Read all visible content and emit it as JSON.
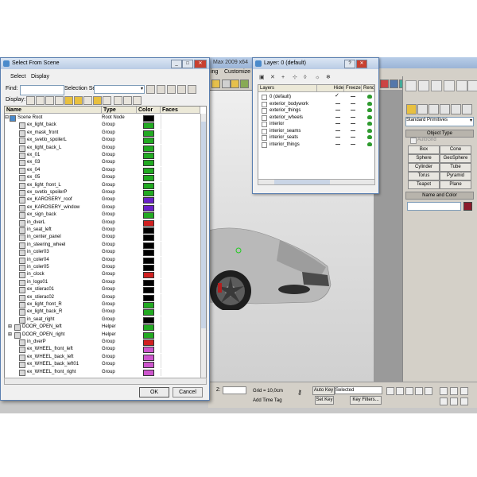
{
  "max_window": {
    "title": "Max  2009 x64",
    "menu": [
      "ing",
      "Customize"
    ],
    "viewport": {},
    "command_panel": {
      "primitive_dropdown": "Standard Primitives",
      "object_type_title": "Object Type",
      "autogrid_label": "AutoGrid",
      "primitives": [
        "Box",
        "Cone",
        "Sphere",
        "GeoSphere",
        "Cylinder",
        "Tube",
        "Torus",
        "Pyramid",
        "Teapot",
        "Plane"
      ],
      "name_color_title": "Name and Color",
      "object_color": "#8b1a2a"
    },
    "status": {
      "z_label": "Z:",
      "grid": "Grid = 10,0cm",
      "add_time_tag": "Add Time Tag",
      "auto_key": "Auto Key",
      "auto_key_value": "Selected",
      "set_key": "Set Key",
      "key_filters": "Key Filters..."
    }
  },
  "layer_window": {
    "title": "Layer: 0 (default)",
    "columns": [
      "Layers",
      "Hide",
      "Freeze",
      "Render"
    ],
    "layers": [
      {
        "name": "0 (default)",
        "current": true
      },
      {
        "name": "exterior_bodywork"
      },
      {
        "name": "exterior_things"
      },
      {
        "name": "exterior_wheels"
      },
      {
        "name": "interior"
      },
      {
        "name": "interior_seams"
      },
      {
        "name": "interior_seats"
      },
      {
        "name": "interior_things"
      }
    ]
  },
  "select_from_scene": {
    "title": "Select From Scene",
    "menu": [
      "Select",
      "Display"
    ],
    "find_label": "Find:",
    "find_value": "",
    "selection_set_label": "Selection Set:",
    "selection_set_value": "",
    "display_label": "Display:",
    "columns": [
      "Name",
      "Type",
      "Color",
      "Faces"
    ],
    "rows": [
      {
        "name": "Scene Root",
        "type": "Root Node",
        "color": "#000000",
        "indent": 0
      },
      {
        "name": "ex_light_back",
        "type": "Group",
        "color": "#22aa22",
        "indent": 1
      },
      {
        "name": "ex_mask_front",
        "type": "Group",
        "color": "#22aa22",
        "indent": 1
      },
      {
        "name": "ex_svetlo_spoilerL",
        "type": "Group",
        "color": "#22aa22",
        "indent": 1
      },
      {
        "name": "ex_light_back_L",
        "type": "Group",
        "color": "#22aa22",
        "indent": 1
      },
      {
        "name": "ex_01",
        "type": "Group",
        "color": "#22aa22",
        "indent": 1
      },
      {
        "name": "ex_03",
        "type": "Group",
        "color": "#22aa22",
        "indent": 1
      },
      {
        "name": "ex_04",
        "type": "Group",
        "color": "#22aa22",
        "indent": 1
      },
      {
        "name": "ex_05",
        "type": "Group",
        "color": "#22aa22",
        "indent": 1
      },
      {
        "name": "ex_light_front_L",
        "type": "Group",
        "color": "#22aa22",
        "indent": 1
      },
      {
        "name": "ex_svetlo_spoilerP",
        "type": "Group",
        "color": "#22aa22",
        "indent": 1
      },
      {
        "name": "ex_KAROSERY_roof",
        "type": "Group",
        "color": "#6a22c8",
        "indent": 1
      },
      {
        "name": "ex_KAROSERY_window",
        "type": "Group",
        "color": "#6a22c8",
        "indent": 1
      },
      {
        "name": "ex_sign_back",
        "type": "Group",
        "color": "#22aa22",
        "indent": 1
      },
      {
        "name": "in_dverL",
        "type": "Group",
        "color": "#d02020",
        "indent": 1
      },
      {
        "name": "in_seat_left",
        "type": "Group",
        "color": "#000000",
        "indent": 1
      },
      {
        "name": "in_center_panel",
        "type": "Group",
        "color": "#000000",
        "indent": 1
      },
      {
        "name": "in_steering_wheel",
        "type": "Group",
        "color": "#000000",
        "indent": 1
      },
      {
        "name": "in_coler03",
        "type": "Group",
        "color": "#000000",
        "indent": 1
      },
      {
        "name": "in_coler04",
        "type": "Group",
        "color": "#000000",
        "indent": 1
      },
      {
        "name": "in_coler05",
        "type": "Group",
        "color": "#000000",
        "indent": 1
      },
      {
        "name": "in_clock",
        "type": "Group",
        "color": "#d02020",
        "indent": 1
      },
      {
        "name": "in_logo01",
        "type": "Group",
        "color": "#000000",
        "indent": 1
      },
      {
        "name": "ex_stierac01",
        "type": "Group",
        "color": "#000000",
        "indent": 1
      },
      {
        "name": "ex_stierac02",
        "type": "Group",
        "color": "#000000",
        "indent": 1
      },
      {
        "name": "ex_light_front_R",
        "type": "Group",
        "color": "#22aa22",
        "indent": 1
      },
      {
        "name": "ex_light_back_R",
        "type": "Group",
        "color": "#22aa22",
        "indent": 1
      },
      {
        "name": "in_seat_right",
        "type": "Group",
        "color": "#000000",
        "indent": 1
      },
      {
        "name": "DOOR_OPEN_left",
        "type": "Helper",
        "color": "#22aa22",
        "indent": 0
      },
      {
        "name": "DOOR_OPEN_right",
        "type": "Helper",
        "color": "#22aa22",
        "indent": 0
      },
      {
        "name": "in_dverP",
        "type": "Group",
        "color": "#d02020",
        "indent": 1
      },
      {
        "name": "ex_WHEEL_front_left",
        "type": "Group",
        "color": "#cc55cc",
        "indent": 1
      },
      {
        "name": "ex_WHEEL_back_left",
        "type": "Group",
        "color": "#cc55cc",
        "indent": 1
      },
      {
        "name": "ex_WHEEL_back_left01",
        "type": "Group",
        "color": "#cc55cc",
        "indent": 1
      },
      {
        "name": "ex_WHEEL_front_right",
        "type": "Group",
        "color": "#cc55cc",
        "indent": 1
      }
    ],
    "ok": "OK",
    "cancel": "Cancel"
  }
}
